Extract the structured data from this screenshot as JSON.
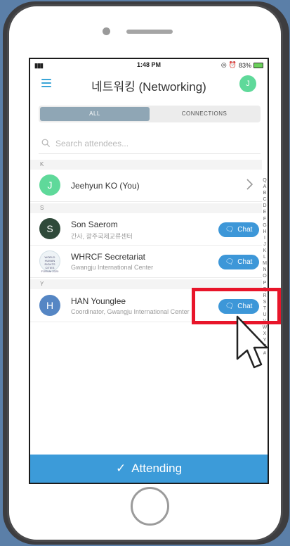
{
  "status_bar": {
    "signal": "▮▮▮",
    "time": "1:48 PM",
    "battery": "83%"
  },
  "header": {
    "title": "네트워킹 (Networking)",
    "avatar_initial": "J"
  },
  "tabs": [
    {
      "label": "ALL",
      "active": true
    },
    {
      "label": "CONNECTIONS",
      "active": false
    }
  ],
  "search": {
    "placeholder": "Search attendees..."
  },
  "sections": [
    {
      "letter": "K",
      "items": [
        {
          "initial": "J",
          "name": "Jeehyun KO (You)",
          "subtitle": "",
          "avatar_color": "#5fd99a",
          "action": "chevron"
        }
      ]
    },
    {
      "letter": "S",
      "items": [
        {
          "initial": "S",
          "name": "Son Saerom",
          "subtitle": "간사, 광주국제교류센터",
          "avatar_color": "#2f4a3a",
          "action": "chat"
        },
        {
          "initial": "WORLD HUMAN RIGHTS CITIES FORUM 2020",
          "name": "WHRCF Secretariat",
          "subtitle": "Gwangju International Center",
          "avatar_color": "#eef3f6",
          "action": "chat"
        }
      ]
    },
    {
      "letter": "Y",
      "items": [
        {
          "initial": "H",
          "name": "HAN Younglee",
          "subtitle": "Coordinator, Gwangju International Center",
          "avatar_color": "#5586c4",
          "action": "chat"
        }
      ]
    }
  ],
  "chat_label": "Chat",
  "alphabet_index": [
    "Q",
    "A",
    "B",
    "C",
    "D",
    "E",
    "F",
    "G",
    "H",
    "I",
    "J",
    "K",
    "L",
    "M",
    "N",
    "O",
    "P",
    "Q",
    "R",
    "S",
    "T",
    "U",
    "V",
    "W",
    "X",
    "Y",
    "Z",
    "#"
  ],
  "footer": {
    "attending_label": "Attending"
  },
  "colors": {
    "accent": "#3c9bd9",
    "highlight": "#e8152a",
    "background": "#5b7fa8"
  }
}
